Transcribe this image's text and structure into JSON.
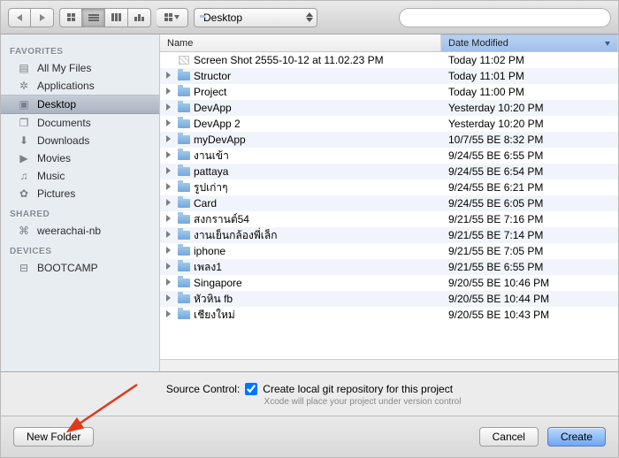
{
  "toolbar": {
    "location_label": "Desktop",
    "search_placeholder": ""
  },
  "sidebar": {
    "sections": [
      {
        "header": "FAVORITES",
        "items": [
          {
            "icon": "allfiles",
            "label": "All My Files"
          },
          {
            "icon": "apps",
            "label": "Applications"
          },
          {
            "icon": "desktop",
            "label": "Desktop",
            "selected": true
          },
          {
            "icon": "docs",
            "label": "Documents"
          },
          {
            "icon": "downloads",
            "label": "Downloads"
          },
          {
            "icon": "movies",
            "label": "Movies"
          },
          {
            "icon": "music",
            "label": "Music"
          },
          {
            "icon": "pictures",
            "label": "Pictures"
          }
        ]
      },
      {
        "header": "SHARED",
        "items": [
          {
            "icon": "computer",
            "label": "weerachai-nb"
          }
        ]
      },
      {
        "header": "DEVICES",
        "items": [
          {
            "icon": "disk",
            "label": "BOOTCAMP"
          }
        ]
      }
    ]
  },
  "columns": {
    "name": "Name",
    "date": "Date Modified"
  },
  "files": [
    {
      "kind": "image",
      "name": "Screen Shot 2555-10-12 at 11.02.23 PM",
      "date": "Today 11:02 PM",
      "expandable": false
    },
    {
      "kind": "folder",
      "name": "Structor",
      "date": "Today 11:01 PM"
    },
    {
      "kind": "folder",
      "name": "Project",
      "date": "Today 11:00 PM"
    },
    {
      "kind": "folder",
      "name": "DevApp",
      "date": "Yesterday 10:20 PM"
    },
    {
      "kind": "folder",
      "name": "DevApp 2",
      "date": "Yesterday 10:20 PM"
    },
    {
      "kind": "folder",
      "name": "myDevApp",
      "date": "10/7/55 BE 8:32 PM"
    },
    {
      "kind": "folder",
      "name": "งานเข้า",
      "date": "9/24/55 BE 6:55 PM"
    },
    {
      "kind": "folder",
      "name": "pattaya",
      "date": "9/24/55 BE 6:54 PM"
    },
    {
      "kind": "folder",
      "name": "รูปเก่าๆ",
      "date": "9/24/55 BE 6:21 PM"
    },
    {
      "kind": "folder",
      "name": "Card",
      "date": "9/24/55 BE 6:05 PM"
    },
    {
      "kind": "folder",
      "name": "สงกรานต์54",
      "date": "9/21/55 BE 7:16 PM"
    },
    {
      "kind": "folder",
      "name": "งานเย็นกล้องพี่เล็ก",
      "date": "9/21/55 BE 7:14 PM"
    },
    {
      "kind": "folder",
      "name": "iphone",
      "date": "9/21/55 BE 7:05 PM"
    },
    {
      "kind": "folder",
      "name": "เพลง1",
      "date": "9/21/55 BE 6:55 PM"
    },
    {
      "kind": "folder",
      "name": "Singapore",
      "date": "9/20/55 BE 10:46 PM"
    },
    {
      "kind": "folder",
      "name": "หัวหิน fb",
      "date": "9/20/55 BE 10:44 PM"
    },
    {
      "kind": "folder",
      "name": "เชียงใหม่",
      "date": "9/20/55 BE 10:43 PM"
    }
  ],
  "sourceControl": {
    "label": "Source Control:",
    "checkbox_label": "Create local git repository for this project",
    "checked": true,
    "subnote": "Xcode will place your project under version control"
  },
  "buttons": {
    "newFolder": "New Folder",
    "cancel": "Cancel",
    "create": "Create"
  },
  "sideIcons": {
    "allfiles": "▤",
    "apps": "✲",
    "desktop": "▣",
    "docs": "❐",
    "downloads": "⬇",
    "movies": "▶",
    "music": "♫",
    "pictures": "✿",
    "computer": "⌘",
    "disk": "⊟"
  }
}
